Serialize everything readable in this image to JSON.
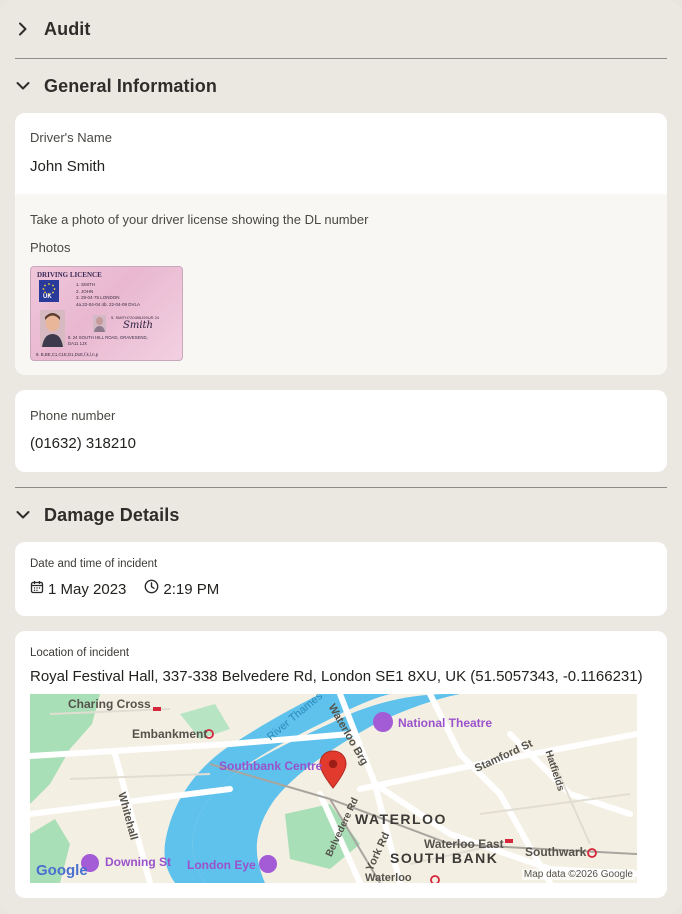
{
  "audit": {
    "title": "Audit"
  },
  "general": {
    "title": "General Information",
    "driver_name_label": "Driver's Name",
    "driver_name_value": "John Smith",
    "photo_instruction": "Take a photo of your driver license showing the DL number",
    "photos_label": "Photos",
    "license": {
      "header": "DRIVING LICENCE",
      "country": "UK",
      "line1": "1. SMITH",
      "line2": "2. JOHN",
      "line3": "3. 29-04-75 LONDON",
      "line4": "4a.22-04-04 4b. 22-04-09  DVLA",
      "line5": "5. SMITH720496J99UR 24",
      "line8": "8. 24 SOUTH HILL ROAD, GRAVESEND,",
      "line8b": "DA11 1JX",
      "line9": "9. B,BE,C1,C1E,D1,D1E,f,k,l,n,p",
      "signature": "Smith"
    },
    "phone_label": "Phone number",
    "phone_value": "(01632) 318210"
  },
  "damage": {
    "title": "Damage Details",
    "datetime_label": "Date and time of incident",
    "date_value": "1 May 2023",
    "time_value": "2:19 PM",
    "location_label": "Location of incident",
    "location_value": "Royal Festival Hall, 337-338 Belvedere Rd, London SE1 8XU, UK (51.5057343, -0.1166231)",
    "map": {
      "labels": {
        "charing_cross": "Charing Cross",
        "embankment": "Embankment",
        "river_thames": "River Thames",
        "waterloo_brg": "Waterloo Brg",
        "national_theatre": "National Theatre",
        "stamford_st": "Stamford St",
        "hatfields": "Hatfields",
        "southbank_centre": "Southbank Centre",
        "whitehall": "Whitehall",
        "belvedere_rd": "Belvedere Rd",
        "waterloo": "WATERLOO",
        "waterloo_east": "Waterloo East",
        "southwark": "Southwark",
        "york_rd": "York Rd",
        "south_bank": "SOUTH BANK",
        "downing_st": "Downing St",
        "london_eye": "London Eye",
        "waterloo_station": "Waterloo",
        "google": "Google",
        "attribution": "Map data ©2026 Google"
      },
      "colors": {
        "water": "#5fc2ec",
        "park": "#9fdcb0",
        "land": "#f4efe3",
        "road": "#ffffff",
        "pin": "#e23b2e",
        "poi": "#a35bd6"
      }
    }
  }
}
